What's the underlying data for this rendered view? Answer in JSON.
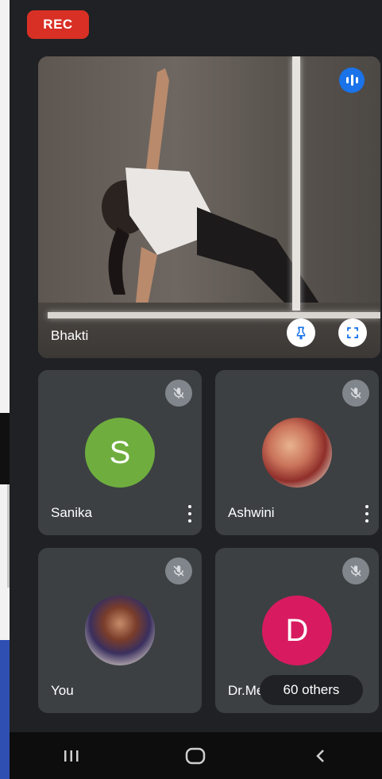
{
  "recording": {
    "label": "REC",
    "color": "#d93025"
  },
  "main_tile": {
    "name": "Bhakti",
    "icons": [
      "talking-indicator-icon",
      "pin-icon",
      "fullscreen-icon"
    ]
  },
  "participants": [
    {
      "name": "Sanika",
      "initial": "S",
      "avatar_color": "#6fae3e",
      "muted": true
    },
    {
      "name": "Ashwini",
      "initial": "",
      "avatar": "photo",
      "muted": true
    },
    {
      "name": "You",
      "initial": "",
      "avatar": "photo",
      "muted": true
    },
    {
      "name": "Dr.Me",
      "initial": "D",
      "avatar_color": "#d81b60",
      "muted": true
    }
  ],
  "others_label": "60 others",
  "nav": {
    "items": [
      "recents-icon",
      "home-icon",
      "back-icon"
    ]
  },
  "colors": {
    "accent": "#1a73e8",
    "tile": "#3c4043",
    "background": "#202124"
  }
}
